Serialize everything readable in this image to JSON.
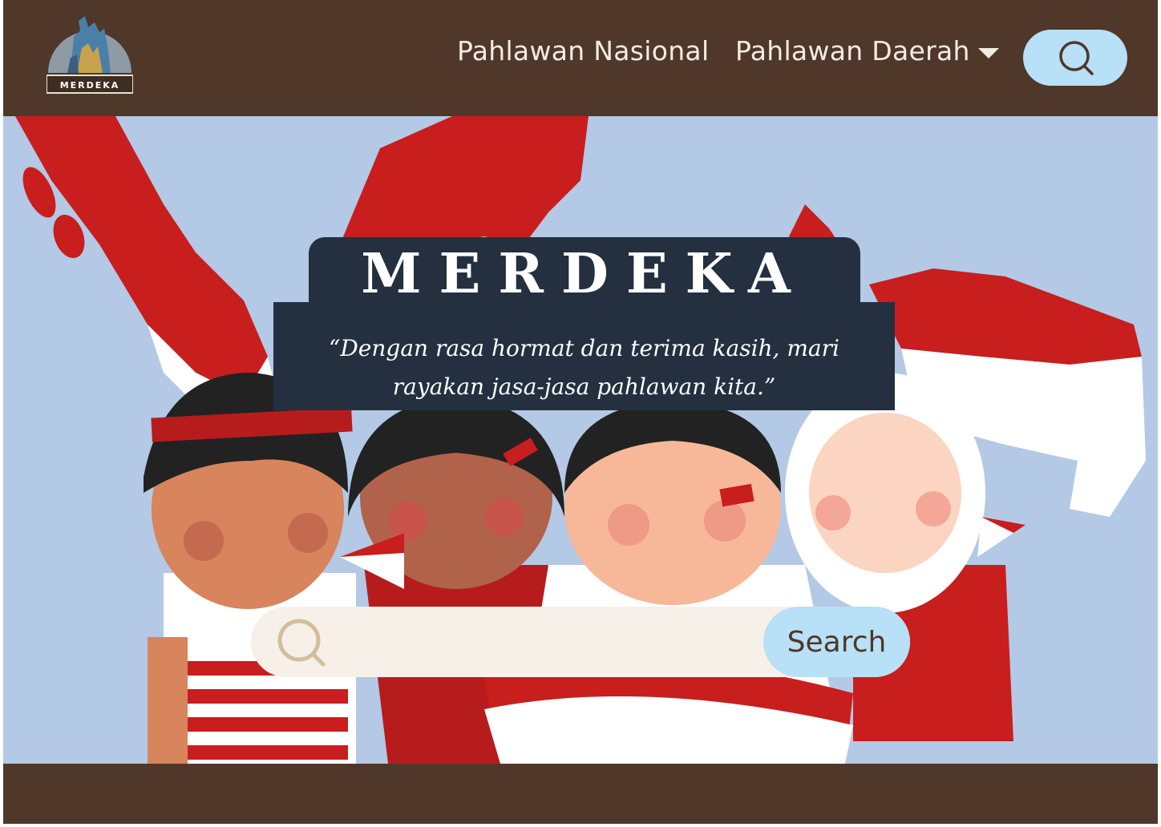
{
  "navbar": {
    "logo_text": "MERDEKA",
    "nav_items": [
      {
        "label": "Pahlawan Nasional"
      },
      {
        "label": "Pahlawan Daerah",
        "has_dropdown": true
      }
    ],
    "search_icon": "search-icon",
    "dropdown_icon": "caret-down-icon"
  },
  "hero": {
    "title": "MERDEKA",
    "quote": "“Dengan rasa hormat dan terima kasih, mari rayakan jasa-jasa pahlawan kita.”",
    "search": {
      "placeholder": "",
      "button_label": "Search",
      "icon": "search-icon"
    },
    "illustration": "children-with-flags-illustration"
  },
  "colors": {
    "brown": "#4f372a",
    "light_blue": "#b8e0f6",
    "sky": "#b3c9e5",
    "navy": "#24303f",
    "red": "#c81e1e",
    "cream": "#f6f0e8"
  }
}
